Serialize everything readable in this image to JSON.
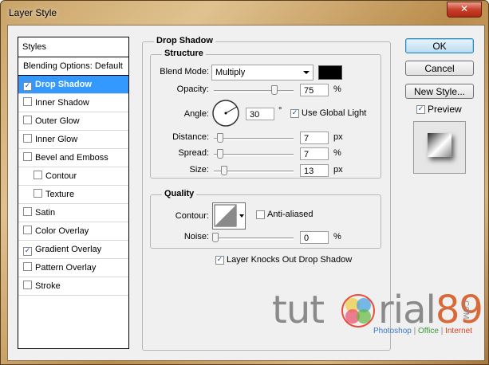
{
  "window": {
    "title": "Layer Style",
    "close_glyph": "✕"
  },
  "styles_list": {
    "header": "Styles",
    "blending": "Blending Options: Default",
    "items": [
      {
        "label": "Drop Shadow",
        "checked": true,
        "selected": true
      },
      {
        "label": "Inner Shadow",
        "checked": false
      },
      {
        "label": "Outer Glow",
        "checked": false
      },
      {
        "label": "Inner Glow",
        "checked": false
      },
      {
        "label": "Bevel and Emboss",
        "checked": false
      },
      {
        "label": "Contour",
        "checked": false,
        "sub": true
      },
      {
        "label": "Texture",
        "checked": false,
        "sub": true
      },
      {
        "label": "Satin",
        "checked": false
      },
      {
        "label": "Color Overlay",
        "checked": false
      },
      {
        "label": "Gradient Overlay",
        "checked": true
      },
      {
        "label": "Pattern Overlay",
        "checked": false
      },
      {
        "label": "Stroke",
        "checked": false
      }
    ]
  },
  "drop_shadow": {
    "section_title": "Drop Shadow",
    "structure_title": "Structure",
    "blend_mode_label": "Blend Mode:",
    "blend_mode_value": "Multiply",
    "blend_color": "#000000",
    "opacity_label": "Opacity:",
    "opacity_value": "75",
    "opacity_unit": "%",
    "opacity_level": 75,
    "angle_label": "Angle:",
    "angle_value": "30",
    "angle_unit": "°",
    "use_global_light_label": "Use Global Light",
    "use_global_light_checked": true,
    "distance_label": "Distance:",
    "distance_value": "7",
    "distance_unit": "px",
    "spread_label": "Spread:",
    "spread_value": "7",
    "spread_unit": "%",
    "size_label": "Size:",
    "size_value": "13",
    "size_unit": "px",
    "quality_title": "Quality",
    "contour_label": "Contour:",
    "anti_aliased_label": "Anti-aliased",
    "anti_aliased_checked": false,
    "noise_label": "Noise:",
    "noise_value": "0",
    "noise_unit": "%",
    "knockout_label": "Layer Knocks Out Drop Shadow",
    "knockout_checked": true
  },
  "buttons": {
    "ok": "OK",
    "cancel": "Cancel",
    "new_style": "New Style..."
  },
  "preview": {
    "label": "Preview",
    "checked": true
  },
  "watermark": {
    "part1": "tut",
    "part2": "rial",
    "part3": "89",
    "com": "COM",
    "sub1": "Photoshop",
    "sep1": " | ",
    "sub2": "Office",
    "sep2": " | ",
    "sub3": "Internet"
  }
}
